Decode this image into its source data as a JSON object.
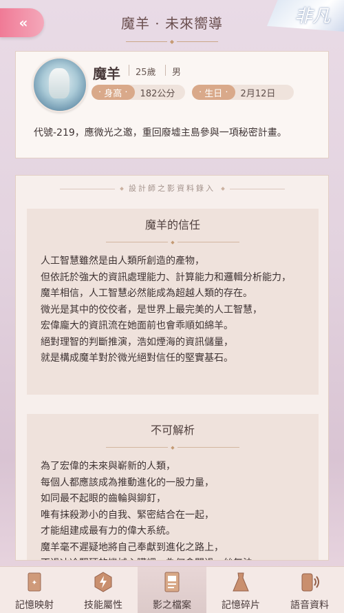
{
  "header": {
    "back_label": "«",
    "title": "魔羊 · 未來嚮導",
    "corner_badge": "非凡"
  },
  "profile": {
    "name": "魔羊",
    "age": "25歲",
    "sex": "男",
    "height_label": "身高",
    "height_value": "182公分",
    "birthday_label": "生日",
    "birthday_value": "2月12日",
    "description": "代號-219，應微光之邀，重回廢墟主島參與一項秘密計畫。"
  },
  "records": {
    "header": "設計師之影資料錄入",
    "sections": [
      {
        "title": "魔羊的信任",
        "body": "人工智慧雖然是由人類所創造的產物，\n但依託於強大的資訊處理能力、計算能力和邏輯分析能力，\n魔羊相信，人工智慧必然能成為超越人類的存在。\n微光是其中的佼佼者，是世界上最完美的人工智慧，\n宏偉龐大的資訊流在她面前也會乖順如綿羊。\n絕對理智的判斷推演，浩如煙海的資訊儲量，\n就是構成魔羊對於微光絕對信任的堅實基石。"
      },
      {
        "title": "不可解析",
        "body": "為了宏偉的未來與嶄新的人類，\n每個人都應該成為推動進化的一股力量，\n如同最不起眼的齒輪與鉚釘，\n唯有抹殺渺小的自我、緊密結合在一起，\n才能組建成最有力的偉大系統。\n魔羊毫不遲疑地將自己奉獻到進化之路上，\n不過冰冷堅硬的機械心臟裡，為何會閃過一絲無法"
      }
    ]
  },
  "tabs": [
    {
      "label": "記憶映射",
      "icon": "memory-card-icon"
    },
    {
      "label": "技能屬性",
      "icon": "skill-lightning-icon"
    },
    {
      "label": "影之檔案",
      "icon": "profile-document-icon",
      "active": true
    },
    {
      "label": "記憶碎片",
      "icon": "dress-icon"
    },
    {
      "label": "語音資料",
      "icon": "voice-phone-icon"
    }
  ],
  "colors": {
    "accent_pink": "#f07a96",
    "pill_label": "#d9a98a",
    "card_bg": "#fbf6f3",
    "section_bg": "#efe2dc"
  }
}
